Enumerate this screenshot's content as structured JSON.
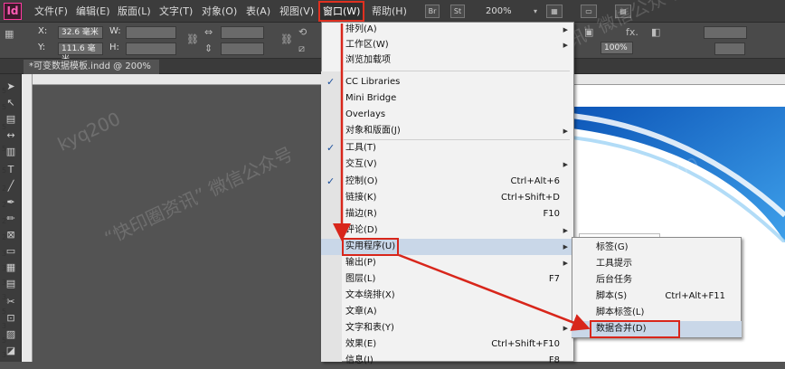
{
  "app": {
    "logo": "Id"
  },
  "menubar": {
    "items": [
      "文件(F)",
      "编辑(E)",
      "版面(L)",
      "文字(T)",
      "对象(O)",
      "表(A)",
      "视图(V)",
      "窗口(W)",
      "帮助(H)"
    ],
    "icons": [
      "Br",
      "St"
    ],
    "zoom": "200%"
  },
  "control": {
    "x_label": "X:",
    "x_value": "32.6 毫米",
    "y_label": "Y:",
    "y_value": "111.6 毫米",
    "w_label": "W:",
    "h_label": "H:",
    "scale_value": "100%"
  },
  "document": {
    "tab_title": "*可变数据模板.indd @ 200%"
  },
  "ruler": {
    "marks": [
      "5",
      "5",
      "5",
      "5",
      "5",
      "2",
      "2",
      "2",
      "2",
      "3",
      "3",
      "3",
      "3",
      "5",
      "3",
      "5",
      "3"
    ]
  },
  "window_menu": {
    "items": [
      {
        "label": "排列(A)",
        "shortcut": "",
        "submenu": true,
        "checked": false
      },
      {
        "label": "工作区(W)",
        "shortcut": "",
        "submenu": true,
        "checked": false
      },
      {
        "label": "浏览加载项",
        "shortcut": "",
        "submenu": false,
        "checked": false
      },
      {
        "label": "CC Libraries",
        "shortcut": "",
        "submenu": false,
        "checked": true
      },
      {
        "label": "Mini Bridge",
        "shortcut": "",
        "submenu": false,
        "checked": false
      },
      {
        "label": "Overlays",
        "shortcut": "",
        "submenu": false,
        "checked": false
      },
      {
        "label": "对象和版面(J)",
        "shortcut": "",
        "submenu": true,
        "checked": false
      },
      {
        "label": "工具(T)",
        "shortcut": "",
        "submenu": false,
        "checked": true
      },
      {
        "label": "交互(V)",
        "shortcut": "",
        "submenu": true,
        "checked": false
      },
      {
        "label": "控制(O)",
        "shortcut": "Ctrl+Alt+6",
        "submenu": false,
        "checked": true
      },
      {
        "label": "链接(K)",
        "shortcut": "Ctrl+Shift+D",
        "submenu": false,
        "checked": false
      },
      {
        "label": "描边(R)",
        "shortcut": "F10",
        "submenu": false,
        "checked": false
      },
      {
        "label": "评论(D)",
        "shortcut": "",
        "submenu": true,
        "checked": false
      },
      {
        "label": "实用程序(U)",
        "shortcut": "",
        "submenu": true,
        "checked": false
      },
      {
        "label": "输出(P)",
        "shortcut": "",
        "submenu": true,
        "checked": false
      },
      {
        "label": "图层(L)",
        "shortcut": "F7",
        "submenu": false,
        "checked": false
      },
      {
        "label": "文本绕排(X)",
        "shortcut": "",
        "submenu": false,
        "checked": false
      },
      {
        "label": "文章(A)",
        "shortcut": "",
        "submenu": false,
        "checked": false
      },
      {
        "label": "文字和表(Y)",
        "shortcut": "",
        "submenu": true,
        "checked": false
      },
      {
        "label": "效果(E)",
        "shortcut": "Ctrl+Shift+F10",
        "submenu": false,
        "checked": false
      },
      {
        "label": "信息(I)",
        "shortcut": "F8",
        "submenu": false,
        "checked": false
      }
    ]
  },
  "utilities_submenu": {
    "items": [
      {
        "label": "标签(G)",
        "shortcut": ""
      },
      {
        "label": "工具提示",
        "shortcut": ""
      },
      {
        "label": "后台任务",
        "shortcut": ""
      },
      {
        "label": "脚本(S)",
        "shortcut": "Ctrl+Alt+F11"
      },
      {
        "label": "脚本标签(L)",
        "shortcut": ""
      },
      {
        "label": "数据合并(D)",
        "shortcut": ""
      }
    ]
  },
  "watermarks": [
    "kyq200",
    "“快印圈资讯” 微信公众号"
  ],
  "colors": {
    "annotation_red": "#d8261b",
    "menu_highlight": "#c9d7e8",
    "logo_pink": "#ff3aa0",
    "check_blue": "#1a4f9c"
  }
}
